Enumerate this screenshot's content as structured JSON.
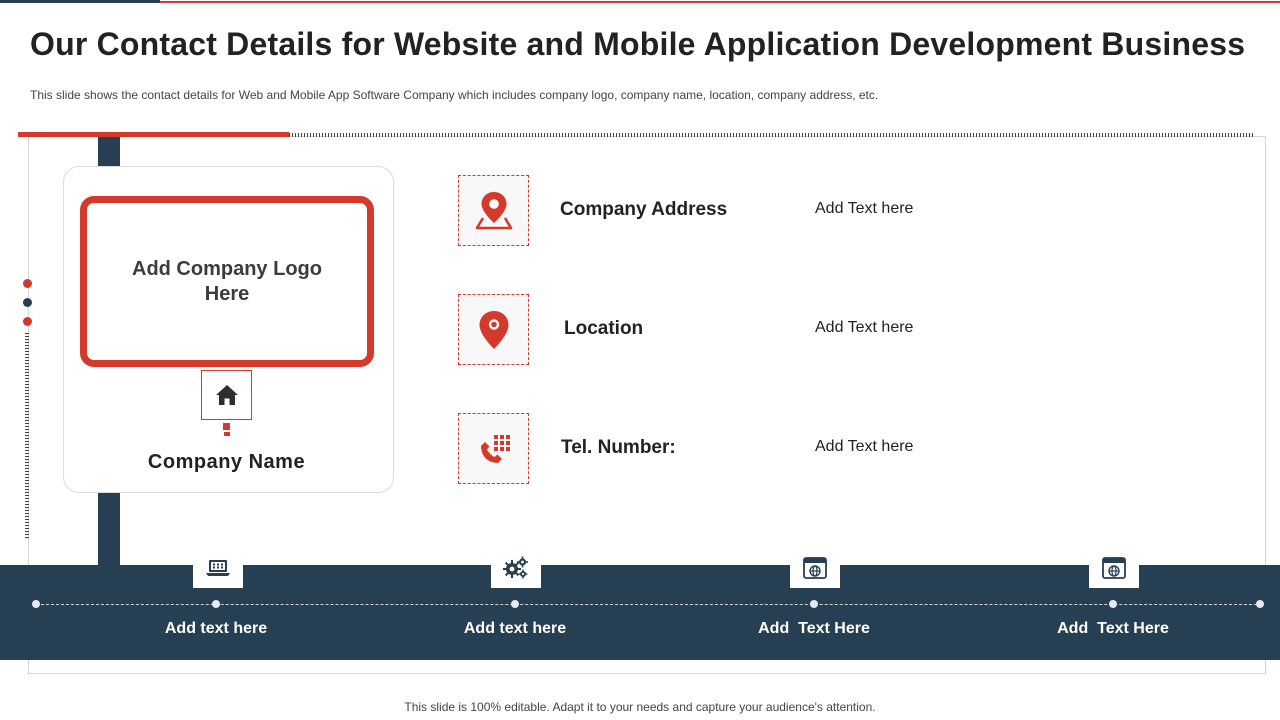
{
  "title": "Our Contact Details for Website and Mobile Application Development Business",
  "subtitle": "This slide shows the contact details for Web and Mobile App Software Company which includes company logo, company name, location, company address, etc.",
  "company_card": {
    "logo_placeholder": "Add Company Logo Here",
    "icon": "home-icon",
    "name": "Company Name"
  },
  "contact_items": [
    {
      "icon": "map-pin-address-icon",
      "label": "Company Address",
      "value": "Add Text here"
    },
    {
      "icon": "location-pin-icon",
      "label": "Location",
      "value": "Add Text here"
    },
    {
      "icon": "phone-keypad-icon",
      "label": "Tel. Number:",
      "value": "Add Text here"
    }
  ],
  "footer_items": [
    {
      "icon": "laptop-icon",
      "label": "Add text here"
    },
    {
      "icon": "gears-icon",
      "label": "Add text here"
    },
    {
      "icon": "web-browser-globe-icon",
      "label": "Add  Text Here"
    },
    {
      "icon": "web-browser-globe-icon",
      "label": "Add  Text Here"
    }
  ],
  "footer_note": "This slide is 100% editable. Adapt it to your needs and capture your audience's attention.",
  "colors": {
    "accent": "#d33a2c",
    "navy": "#263f52",
    "text": "#222222"
  }
}
